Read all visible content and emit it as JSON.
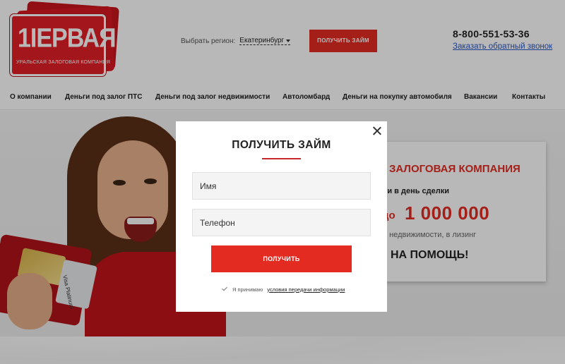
{
  "header": {
    "logo": {
      "word": "1IЕРВАЯ",
      "subtitle": "УРАЛЬСКАЯ ЗАЛОГОВАЯ КОМПАНИЯ"
    },
    "region": {
      "label": "Выбрать регион:",
      "selected": "Екатеринбург"
    },
    "loan_button_label": "ПОЛУЧИТЬ ЗАЙМ",
    "phone": "8-800-551-53-36",
    "callback_label": "Заказать обратный звонок"
  },
  "nav": {
    "items": [
      {
        "label": "О компании"
      },
      {
        "label": "Деньги под залог ПТС"
      },
      {
        "label": "Деньги под залог недвижимости"
      },
      {
        "label": "Автоломбард"
      },
      {
        "label": "Деньги на покупку автомобиля"
      },
      {
        "label": "Вакансии"
      },
      {
        "label": "Контакты"
      }
    ]
  },
  "hero": {
    "card_text": "Visa Platinum",
    "promo": {
      "title": "ЗАЛОГОВАЯ КОМПАНИЯ",
      "subtitle": "ьги в день сделки",
      "amount_prefix": "до",
      "amount": "1 000 000",
      "note": ", недвижимости, в лизинг",
      "cta": "НА ПОМОЩЬ!"
    }
  },
  "modal": {
    "title": "ПОЛУЧИТЬ ЗАЙМ",
    "name_placeholder": "Имя",
    "phone_placeholder": "Телефон",
    "submit_label": "ПОЛУЧИТЬ",
    "agree_text": "Я принимаю",
    "agree_link": "условия передачи информации"
  },
  "colors": {
    "accent": "#e32b22",
    "link": "#2a57c4",
    "overlay": "rgba(0,0,0,0.28)"
  },
  "icons": [
    "close-icon",
    "chevron-down-icon",
    "checkmark-icon"
  ]
}
